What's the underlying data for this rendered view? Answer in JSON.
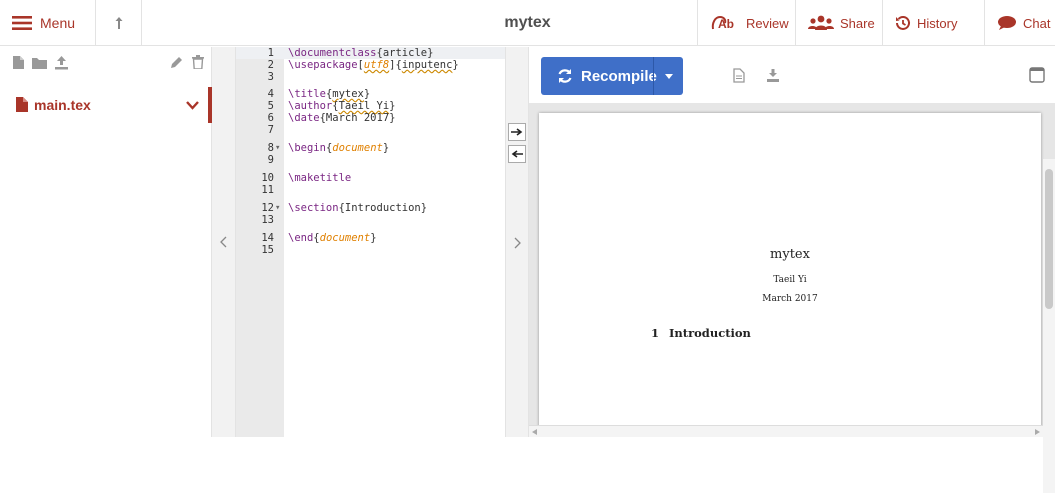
{
  "topbar": {
    "menu_label": "Menu",
    "project_title": "mytex",
    "review_label": "Review",
    "share_label": "Share",
    "history_label": "History",
    "chat_label": "Chat"
  },
  "filetree": {
    "files": [
      {
        "label": "main.tex"
      }
    ]
  },
  "editor": {
    "active_line": 1,
    "lines": [
      {
        "n": "1",
        "text": "\\documentclass{article}"
      },
      {
        "n": "2",
        "text": "\\usepackage[utf8]{inputenc}"
      },
      {
        "n": "3",
        "text": ""
      },
      {
        "n": "4",
        "text": "\\title{mytex}"
      },
      {
        "n": "5",
        "text": "\\author{Taeil Yi}"
      },
      {
        "n": "6",
        "text": "\\date{March 2017}"
      },
      {
        "n": "7",
        "text": ""
      },
      {
        "n": "8",
        "text": "\\begin{document}"
      },
      {
        "n": "9",
        "text": ""
      },
      {
        "n": "10",
        "text": "\\maketitle"
      },
      {
        "n": "11",
        "text": ""
      },
      {
        "n": "12",
        "text": "\\section{Introduction}"
      },
      {
        "n": "13",
        "text": ""
      },
      {
        "n": "14",
        "text": "\\end{document}"
      },
      {
        "n": "15",
        "text": ""
      }
    ]
  },
  "pdf": {
    "recompile_label": "Recompile",
    "doc_title": "mytex",
    "doc_author": "Taeil Yi",
    "doc_date": "March 2017",
    "section_number": "1",
    "section_title": "Introduction"
  },
  "colors": {
    "accent": "#a93529",
    "recompile_blue": "#3f6fc8"
  }
}
